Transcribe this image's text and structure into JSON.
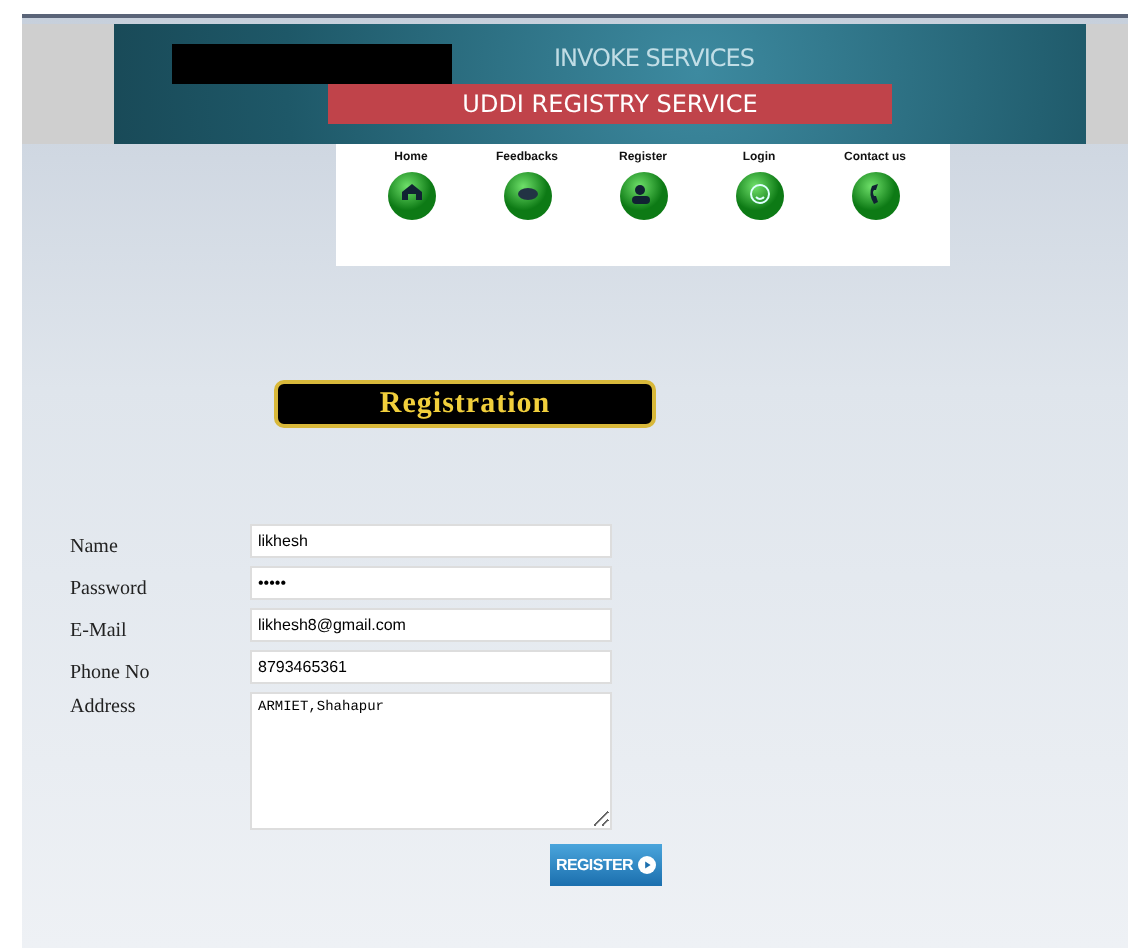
{
  "banner": {
    "subtitle": "INVOKE SERVICES",
    "title": "UDDI REGISTRY SERVICE"
  },
  "nav": [
    {
      "label": "Home",
      "kind": "home"
    },
    {
      "label": "Feedbacks",
      "kind": "chat"
    },
    {
      "label": "Register",
      "kind": "users"
    },
    {
      "label": "Login",
      "kind": "smile"
    },
    {
      "label": "Contact us",
      "kind": "phone"
    }
  ],
  "heading": "Registration",
  "form": [
    {
      "label": "Name",
      "kind": "text",
      "value": "likhesh"
    },
    {
      "label": "Password",
      "kind": "text",
      "value": "•••••"
    },
    {
      "label": "E-Mail",
      "kind": "text",
      "value": "likhesh8@gmail.com"
    },
    {
      "label": "Phone No",
      "kind": "text",
      "value": "8793465361"
    },
    {
      "label": "Address",
      "kind": "area",
      "value": "ARMIET,Shahapur"
    }
  ],
  "submit": "REGISTER"
}
